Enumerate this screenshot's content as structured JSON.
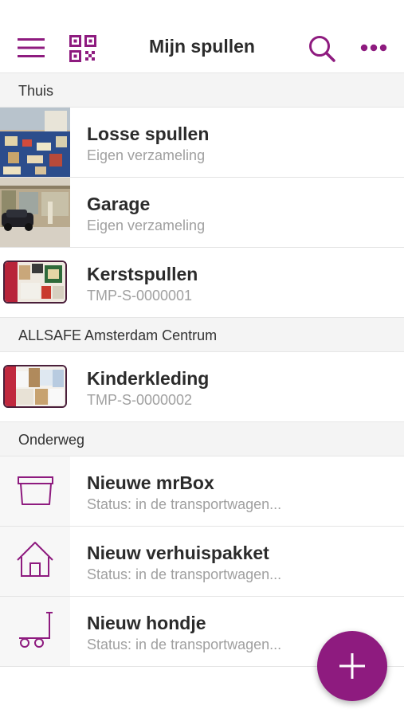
{
  "header": {
    "title": "Mijn spullen",
    "icons": [
      "menu-icon",
      "qr-code-icon",
      "search-icon",
      "more-icon"
    ]
  },
  "colors": {
    "accent": "#8e1b7f",
    "section_bg": "#f4f4f4",
    "subtitle": "#a0a0a0"
  },
  "sections": [
    {
      "label": "Thuis",
      "items": [
        {
          "name": "Losse spullen",
          "sub": "Eigen verzameling",
          "image": "photo-room"
        },
        {
          "name": "Garage",
          "sub": "Eigen verzameling",
          "image": "photo-garage"
        },
        {
          "name": "Kerstspullen",
          "sub": "TMP-S-0000001",
          "image": "photo-box-christmas"
        }
      ]
    },
    {
      "label": "ALLSAFE Amsterdam Centrum",
      "items": [
        {
          "name": "Kinderkleding",
          "sub": "TMP-S-0000002",
          "image": "photo-box-clothes"
        }
      ]
    },
    {
      "label": "Onderweg",
      "items": [
        {
          "name": "Nieuwe mrBox",
          "sub": "Status: in de transportwagen...",
          "image": "box-icon"
        },
        {
          "name": "Nieuw verhuispakket",
          "sub": "Status: in de transportwagen...",
          "image": "house-icon"
        },
        {
          "name": "Nieuw hondje",
          "sub": "Status: in de transportwagen...",
          "image": "hand-truck-icon"
        }
      ]
    }
  ],
  "fab": {
    "icon": "plus-icon"
  }
}
